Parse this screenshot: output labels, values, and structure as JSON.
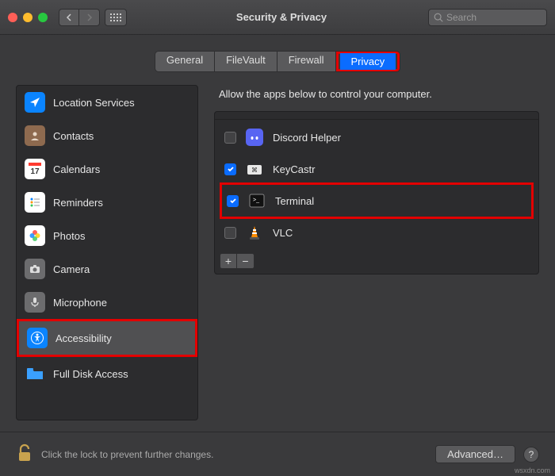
{
  "window": {
    "title": "Security & Privacy",
    "search_placeholder": "Search"
  },
  "tabs": [
    {
      "label": "General",
      "active": false
    },
    {
      "label": "FileVault",
      "active": false
    },
    {
      "label": "Firewall",
      "active": false
    },
    {
      "label": "Privacy",
      "active": true
    }
  ],
  "sidebar": {
    "items": [
      {
        "label": "Location Services",
        "icon": "location",
        "color": "#0a84ff"
      },
      {
        "label": "Contacts",
        "icon": "contacts",
        "color": "#8e6a4f"
      },
      {
        "label": "Calendars",
        "icon": "calendar",
        "color": "#ffffff"
      },
      {
        "label": "Reminders",
        "icon": "reminders",
        "color": "#ffffff"
      },
      {
        "label": "Photos",
        "icon": "photos",
        "color": "#ffffff"
      },
      {
        "label": "Camera",
        "icon": "camera",
        "color": "#6c6c6e"
      },
      {
        "label": "Microphone",
        "icon": "microphone",
        "color": "#6c6c6e"
      },
      {
        "label": "Accessibility",
        "icon": "accessibility",
        "color": "#0a84ff",
        "selected": true,
        "highlight": true
      },
      {
        "label": "Full Disk Access",
        "icon": "folder",
        "color": "#0a84ff"
      }
    ]
  },
  "main": {
    "description": "Allow the apps below to control your computer.",
    "apps": [
      {
        "name": "Discord Helper",
        "checked": false,
        "icon": "discord"
      },
      {
        "name": "KeyCastr",
        "checked": true,
        "icon": "keycastr"
      },
      {
        "name": "Terminal",
        "checked": true,
        "icon": "terminal",
        "highlight": true
      },
      {
        "name": "VLC",
        "checked": false,
        "icon": "vlc"
      }
    ],
    "buttons": {
      "plus": "+",
      "minus": "−"
    }
  },
  "footer": {
    "lock_text": "Click the lock to prevent further changes.",
    "advanced_label": "Advanced…",
    "help_label": "?"
  },
  "watermark": "wsxdn.com"
}
